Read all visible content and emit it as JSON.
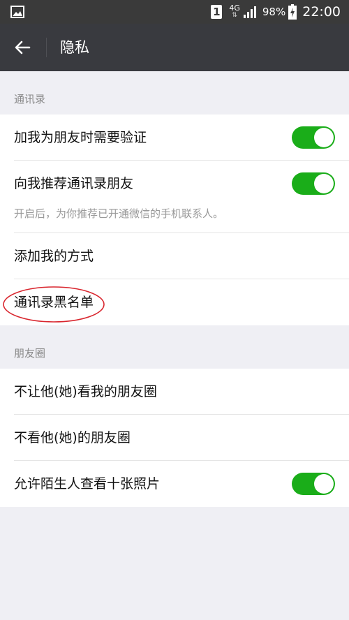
{
  "status_bar": {
    "sim_slot": "1",
    "network": "4G",
    "battery_percent": "98%",
    "time": "22:00",
    "icons": [
      "image-icon",
      "signal-icon",
      "battery-charging-icon"
    ]
  },
  "toolbar": {
    "title": "隐私",
    "back_icon": "arrow-left-icon"
  },
  "sections": {
    "contacts": {
      "header": "通讯录",
      "items": [
        {
          "label": "加我为朋友时需要验证",
          "toggle": true
        },
        {
          "label": "向我推荐通讯录朋友",
          "toggle": true,
          "description": "开启后，为你推荐已开通微信的手机联系人。"
        },
        {
          "label": "添加我的方式"
        },
        {
          "label": "通讯录黑名单"
        }
      ]
    },
    "moments": {
      "header": "朋友圈",
      "items": [
        {
          "label": "不让他(她)看我的朋友圈"
        },
        {
          "label": "不看他(她)的朋友圈"
        },
        {
          "label": "允许陌生人查看十张照片",
          "toggle": true
        }
      ]
    }
  },
  "colors": {
    "toolbar_bg": "#393a3f",
    "toggle_on": "#1aad19",
    "page_bg": "#efeff4",
    "annotation": "#d9262e"
  }
}
